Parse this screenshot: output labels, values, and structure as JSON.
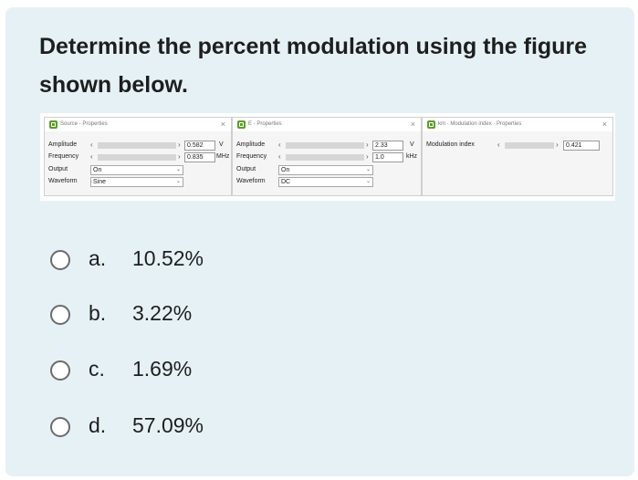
{
  "question": "Determine the percent modulation using the figure shown below.",
  "figure": {
    "panels": [
      {
        "title": "Source - Properties",
        "rows": [
          {
            "label": "Amplitude",
            "value": "0.582",
            "unit": "V"
          },
          {
            "label": "Frequency",
            "value": "0.835",
            "unit": "MHz"
          }
        ],
        "selects": [
          {
            "label": "Output",
            "value": "On"
          },
          {
            "label": "Waveform",
            "value": "Sine"
          }
        ]
      },
      {
        "title": "E - Properties",
        "rows": [
          {
            "label": "Amplitude",
            "value": "2.33",
            "unit": "V"
          },
          {
            "label": "Frequency",
            "value": "1.0",
            "unit": "kHz"
          }
        ],
        "selects": [
          {
            "label": "Output",
            "value": "On"
          },
          {
            "label": "Waveform",
            "value": "DC"
          }
        ]
      },
      {
        "title": "km · Modulation index · Properties",
        "rows": [
          {
            "label": "Modulation index",
            "value": "0.421",
            "unit": ""
          }
        ]
      }
    ],
    "left_arrow": "‹",
    "right_arrow": "›",
    "close_glyph": "×",
    "chevron": "⌄"
  },
  "options": [
    {
      "letter": "a.",
      "text": "10.52%"
    },
    {
      "letter": "b.",
      "text": "3.22%"
    },
    {
      "letter": "c.",
      "text": "1.69%"
    },
    {
      "letter": "d.",
      "text": "57.09%"
    }
  ],
  "icons": {
    "app_icon": "green-app-icon",
    "radio": "radio-button"
  }
}
